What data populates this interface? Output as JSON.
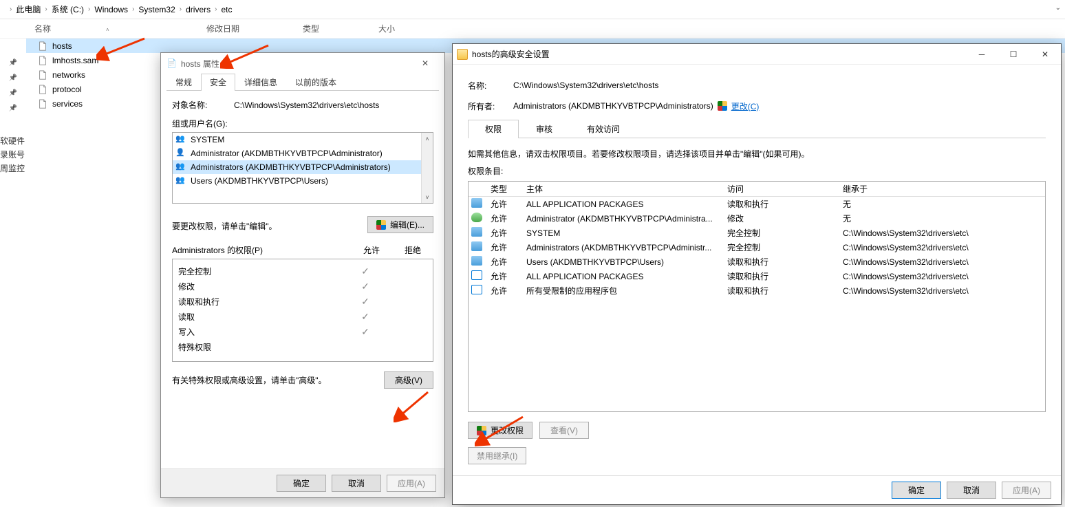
{
  "breadcrumb": {
    "segs": [
      "此电脑",
      "系统 (C:)",
      "Windows",
      "System32",
      "drivers",
      "etc"
    ]
  },
  "columns": {
    "name": "名称",
    "date": "修改日期",
    "type": "类型",
    "size": "大小"
  },
  "files": {
    "items": [
      {
        "name": "hosts",
        "selected": true
      },
      {
        "name": "lmhosts.sam",
        "selected": false
      },
      {
        "name": "networks",
        "selected": false
      },
      {
        "name": "protocol",
        "selected": false
      },
      {
        "name": "services",
        "selected": false
      }
    ]
  },
  "sidebar_truncated": {
    "a": "软硬件",
    "b": "录账号",
    "c": "周监控"
  },
  "prop": {
    "title": "hosts 属性",
    "tabs": {
      "general": "常规",
      "security": "安全",
      "details": "详细信息",
      "prev": "以前的版本"
    },
    "obj_label": "对象名称:",
    "obj_path": "C:\\Windows\\System32\\drivers\\etc\\hosts",
    "groups_label": "组或用户名(G):",
    "groups": [
      {
        "name": "SYSTEM",
        "icon": "users"
      },
      {
        "name": "Administrator (AKDMBTHKYVBTPCP\\Administrator)",
        "icon": "user"
      },
      {
        "name": "Administrators (AKDMBTHKYVBTPCP\\Administrators)",
        "icon": "users",
        "selected": true
      },
      {
        "name": "Users (AKDMBTHKYVBTPCP\\Users)",
        "icon": "users"
      }
    ],
    "edit_hint": "要更改权限，请单击\"编辑\"。",
    "edit_btn": "编辑(E)...",
    "perm_title": "Administrators 的权限(P)",
    "perm_allow": "允许",
    "perm_deny": "拒绝",
    "perms": [
      {
        "name": "完全控制",
        "allow": true
      },
      {
        "name": "修改",
        "allow": true
      },
      {
        "name": "读取和执行",
        "allow": true
      },
      {
        "name": "读取",
        "allow": true
      },
      {
        "name": "写入",
        "allow": true
      },
      {
        "name": "特殊权限",
        "allow": false
      }
    ],
    "adv_hint": "有关特殊权限或高级设置，请单击\"高级\"。",
    "adv_btn": "高级(V)",
    "ok": "确定",
    "cancel": "取消",
    "apply": "应用(A)"
  },
  "adv": {
    "title": "hosts的高级安全设置",
    "name_lbl": "名称:",
    "name_val": "C:\\Windows\\System32\\drivers\\etc\\hosts",
    "owner_lbl": "所有者:",
    "owner_val": "Administrators (AKDMBTHKYVBTPCP\\Administrators)",
    "change_link": "更改(C)",
    "tabs": {
      "perm": "权限",
      "audit": "审核",
      "eff": "有效访问"
    },
    "hint": "如需其他信息，请双击权限项目。若要修改权限项目，请选择该项目并单击\"编辑\"(如果可用)。",
    "entries_lbl": "权限条目:",
    "head": {
      "type": "类型",
      "principal": "主体",
      "access": "访问",
      "inherit": "继承于"
    },
    "entries": [
      {
        "icon": "users",
        "type": "允许",
        "principal": "ALL APPLICATION PACKAGES",
        "access": "读取和执行",
        "inherit": "无"
      },
      {
        "icon": "user",
        "type": "允许",
        "principal": "Administrator (AKDMBTHKYVBTPCP\\Administra...",
        "access": "修改",
        "inherit": "无"
      },
      {
        "icon": "users",
        "type": "允许",
        "principal": "SYSTEM",
        "access": "完全控制",
        "inherit": "C:\\Windows\\System32\\drivers\\etc\\"
      },
      {
        "icon": "users",
        "type": "允许",
        "principal": "Administrators (AKDMBTHKYVBTPCP\\Administr...",
        "access": "完全控制",
        "inherit": "C:\\Windows\\System32\\drivers\\etc\\"
      },
      {
        "icon": "users",
        "type": "允许",
        "principal": "Users (AKDMBTHKYVBTPCP\\Users)",
        "access": "读取和执行",
        "inherit": "C:\\Windows\\System32\\drivers\\etc\\"
      },
      {
        "icon": "pkg",
        "type": "允许",
        "principal": "ALL APPLICATION PACKAGES",
        "access": "读取和执行",
        "inherit": "C:\\Windows\\System32\\drivers\\etc\\"
      },
      {
        "icon": "pkg",
        "type": "允许",
        "principal": "所有受限制的应用程序包",
        "access": "读取和执行",
        "inherit": "C:\\Windows\\System32\\drivers\\etc\\"
      }
    ],
    "change_perm": "更改权限",
    "view": "查看(V)",
    "disable_inherit": "禁用继承(I)",
    "ok": "确定",
    "cancel": "取消",
    "apply": "应用(A)"
  }
}
